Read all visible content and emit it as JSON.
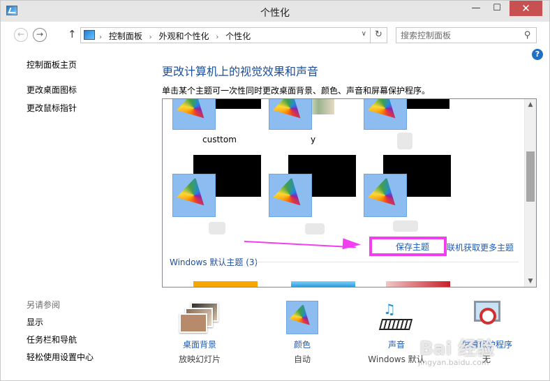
{
  "window": {
    "title": "个性化",
    "min": "—",
    "max": "☐",
    "close": "✕"
  },
  "nav": {
    "back": "←",
    "forward": "→",
    "up": "↑",
    "breadcrumbs": [
      "控制面板",
      "外观和个性化",
      "个性化"
    ],
    "crumb_sep": "›",
    "dropdown": "∨",
    "refresh": "↻",
    "search_placeholder": "搜索控制面板",
    "help": "?"
  },
  "sidebar": {
    "home": "控制面板主页",
    "change_desktop_icons": "更改桌面图标",
    "change_mouse_pointer": "更改鼠标指针",
    "see_also": "另请参阅",
    "display": "显示",
    "taskbar": "任务栏和导航",
    "ease_of_access": "轻松使用设置中心"
  },
  "main": {
    "title": "更改计算机上的视觉效果和声音",
    "description": "单击某个主题可一次性同时更改桌面背景、颜色、声音和屏幕保护程序。",
    "themes": [
      {
        "label": "custtom"
      },
      {
        "label": "y"
      }
    ],
    "save_theme": "保存主题",
    "get_more_online": "联机获取更多主题",
    "default_section": "Windows 默认主题 (3)",
    "default_theme_colors": [
      "#f7a700",
      "#1c8fd6",
      "#c8202a"
    ],
    "scroll_up": "▲",
    "scroll_down": "▼"
  },
  "settings": {
    "desktop_background": {
      "label": "桌面背景",
      "value": "放映幻灯片"
    },
    "color": {
      "label": "颜色",
      "value": "自动"
    },
    "sounds": {
      "label": "声音",
      "value": "Windows 默认"
    },
    "screen_saver": {
      "label": "屏幕保护程序",
      "value": "无"
    }
  },
  "colors": {
    "link": "#1c5bb8",
    "heading": "#1e4e9a",
    "highlight": "#f03ef0",
    "close_button": "#c75050"
  },
  "watermark": {
    "text": "Bai 经验",
    "sub": "jingyan.baidu.com"
  }
}
